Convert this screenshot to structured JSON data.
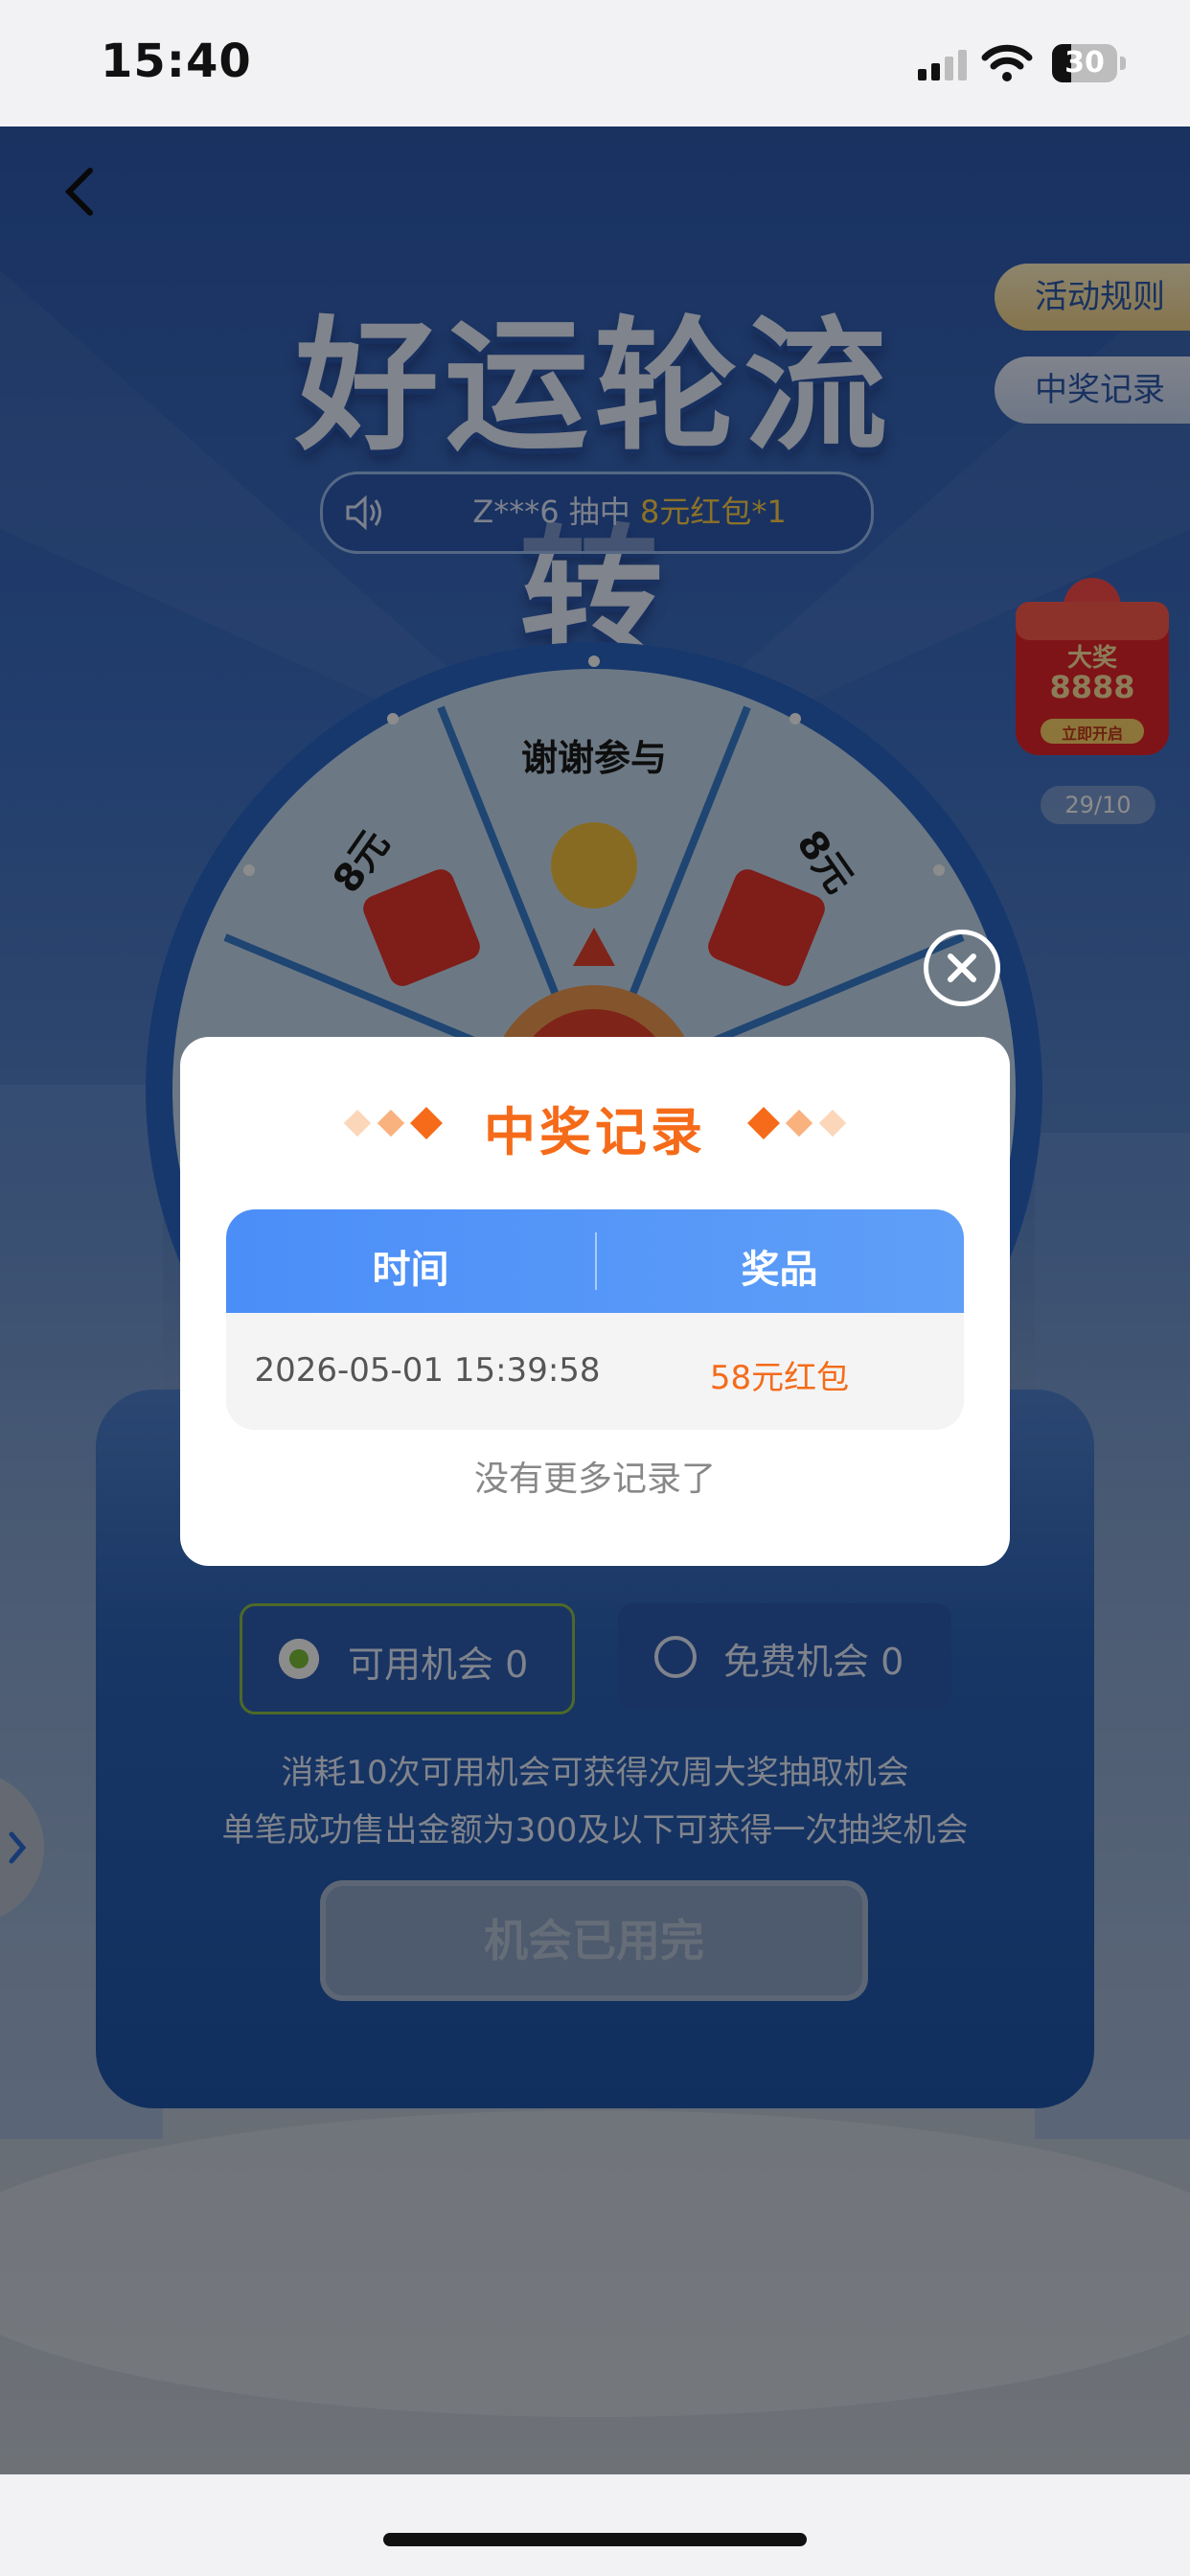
{
  "status_bar": {
    "time": "15:40",
    "battery": "30",
    "battery_level": 0.3
  },
  "page": {
    "title": "好运轮流转",
    "rules_button": "活动规则",
    "records_button": "中奖记录",
    "marquee": {
      "prefix": "Z***6 抽中 ",
      "highlight": "8元红包*1"
    },
    "big_prize": {
      "label": "大奖",
      "amount": "8888",
      "cta": "立即开启",
      "count": "29/10"
    },
    "wheel": {
      "segment_left": "8元",
      "segment_center": "谢谢参与",
      "segment_right": "8元"
    },
    "chances": {
      "available": "可用机会 0",
      "free": "免费机会 0"
    },
    "desc_line1": "消耗10次可用机会可获得次周大奖抽取机会",
    "desc_line2": "单笔成功售出金额为300及以下可获得一次抽奖机会",
    "used_button": "机会已用完"
  },
  "modal": {
    "title": "中奖记录",
    "columns": [
      "时间",
      "奖品"
    ],
    "rows": [
      {
        "time": "2026-05-01 15:39:58",
        "prize": "58元红包"
      }
    ],
    "footer": "没有更多记录了"
  },
  "colors": {
    "accent_orange": "#f56b19",
    "header_blue": "#4b8ef8",
    "page_blue": "#2f5bb0"
  }
}
